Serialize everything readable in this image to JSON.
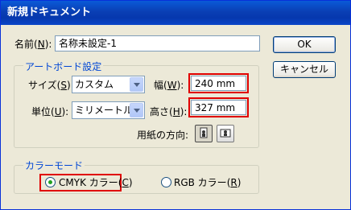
{
  "title": "新規ドキュメント",
  "name": {
    "label": "名前",
    "key": "N",
    "value": "名称未設定-1"
  },
  "buttons": {
    "ok": "OK",
    "cancel": "キャンセル"
  },
  "artboard": {
    "legend": "アートボード設定",
    "size": {
      "label": "サイズ",
      "key": "S",
      "value": "カスタム"
    },
    "width": {
      "label": "幅",
      "key": "W",
      "value": "240 mm"
    },
    "units": {
      "label": "単位",
      "key": "U",
      "value": "ミリメートル"
    },
    "height": {
      "label": "高さ",
      "key": "H",
      "value": "327 mm"
    },
    "orientation": {
      "label": "用紙の方向:"
    }
  },
  "color_mode": {
    "legend": "カラーモード",
    "cmyk": {
      "label": "CMYK カラー",
      "key": "C",
      "checked": true
    },
    "rgb": {
      "label": "RGB カラー",
      "key": "R",
      "checked": false
    }
  }
}
